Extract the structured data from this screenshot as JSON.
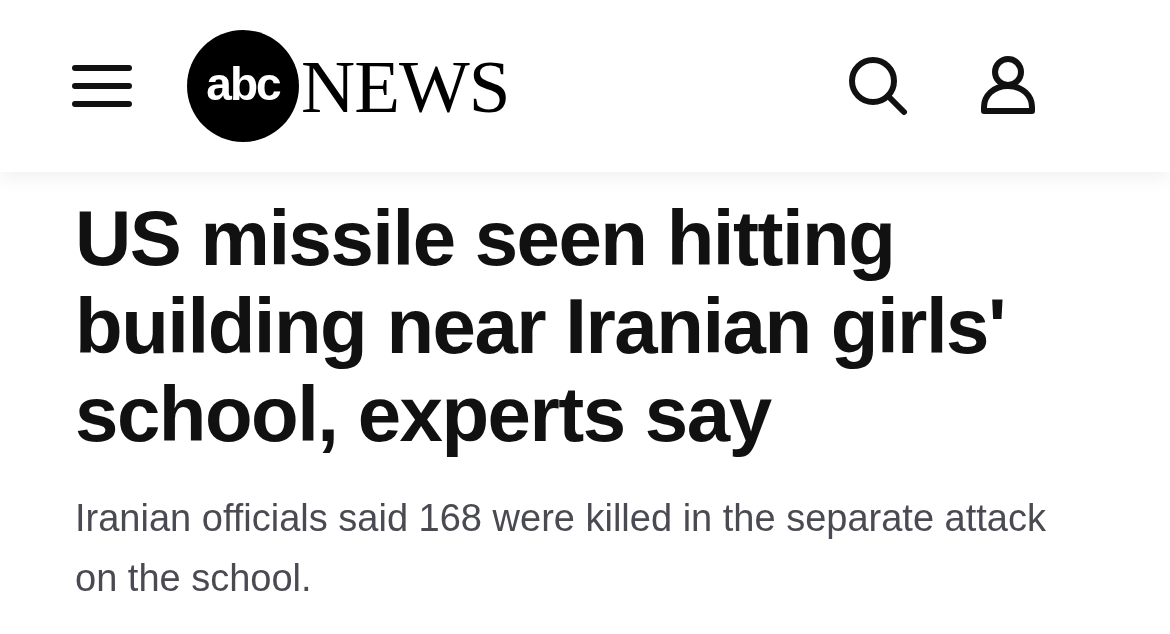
{
  "header": {
    "logo": {
      "mark": "abc",
      "wordmark": "NEWS"
    }
  },
  "article": {
    "headline": "US missile seen hitting building near Iranian girls' school, experts say",
    "summary": "Iranian officials said 168 were killed in the separate attack on the school."
  }
}
